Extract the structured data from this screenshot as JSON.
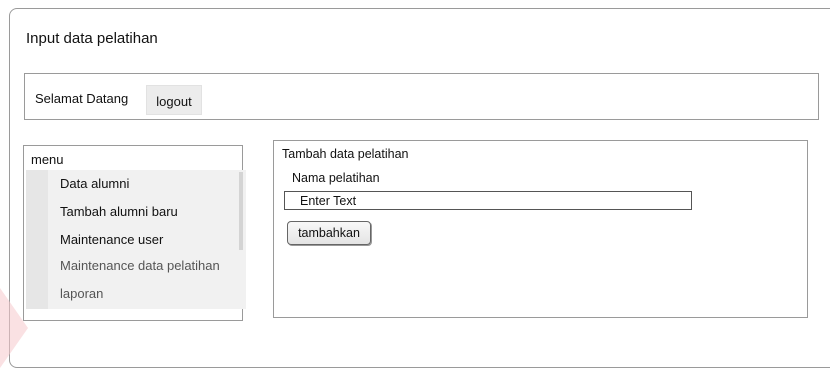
{
  "page": {
    "title": "Input data pelatihan"
  },
  "welcome": {
    "text": "Selamat Datang",
    "logout_label": "logout"
  },
  "menu": {
    "header": "menu",
    "items": [
      {
        "label": "Data alumni"
      },
      {
        "label": "Tambah alumni baru"
      },
      {
        "label": "Maintenance user"
      },
      {
        "label": "Maintenance data pelatihan"
      },
      {
        "label": "laporan"
      }
    ]
  },
  "form": {
    "title": "Tambah data pelatihan",
    "field_label": "Nama pelatihan",
    "input_placeholder": "Enter Text",
    "submit_label": "tambahkan"
  }
}
